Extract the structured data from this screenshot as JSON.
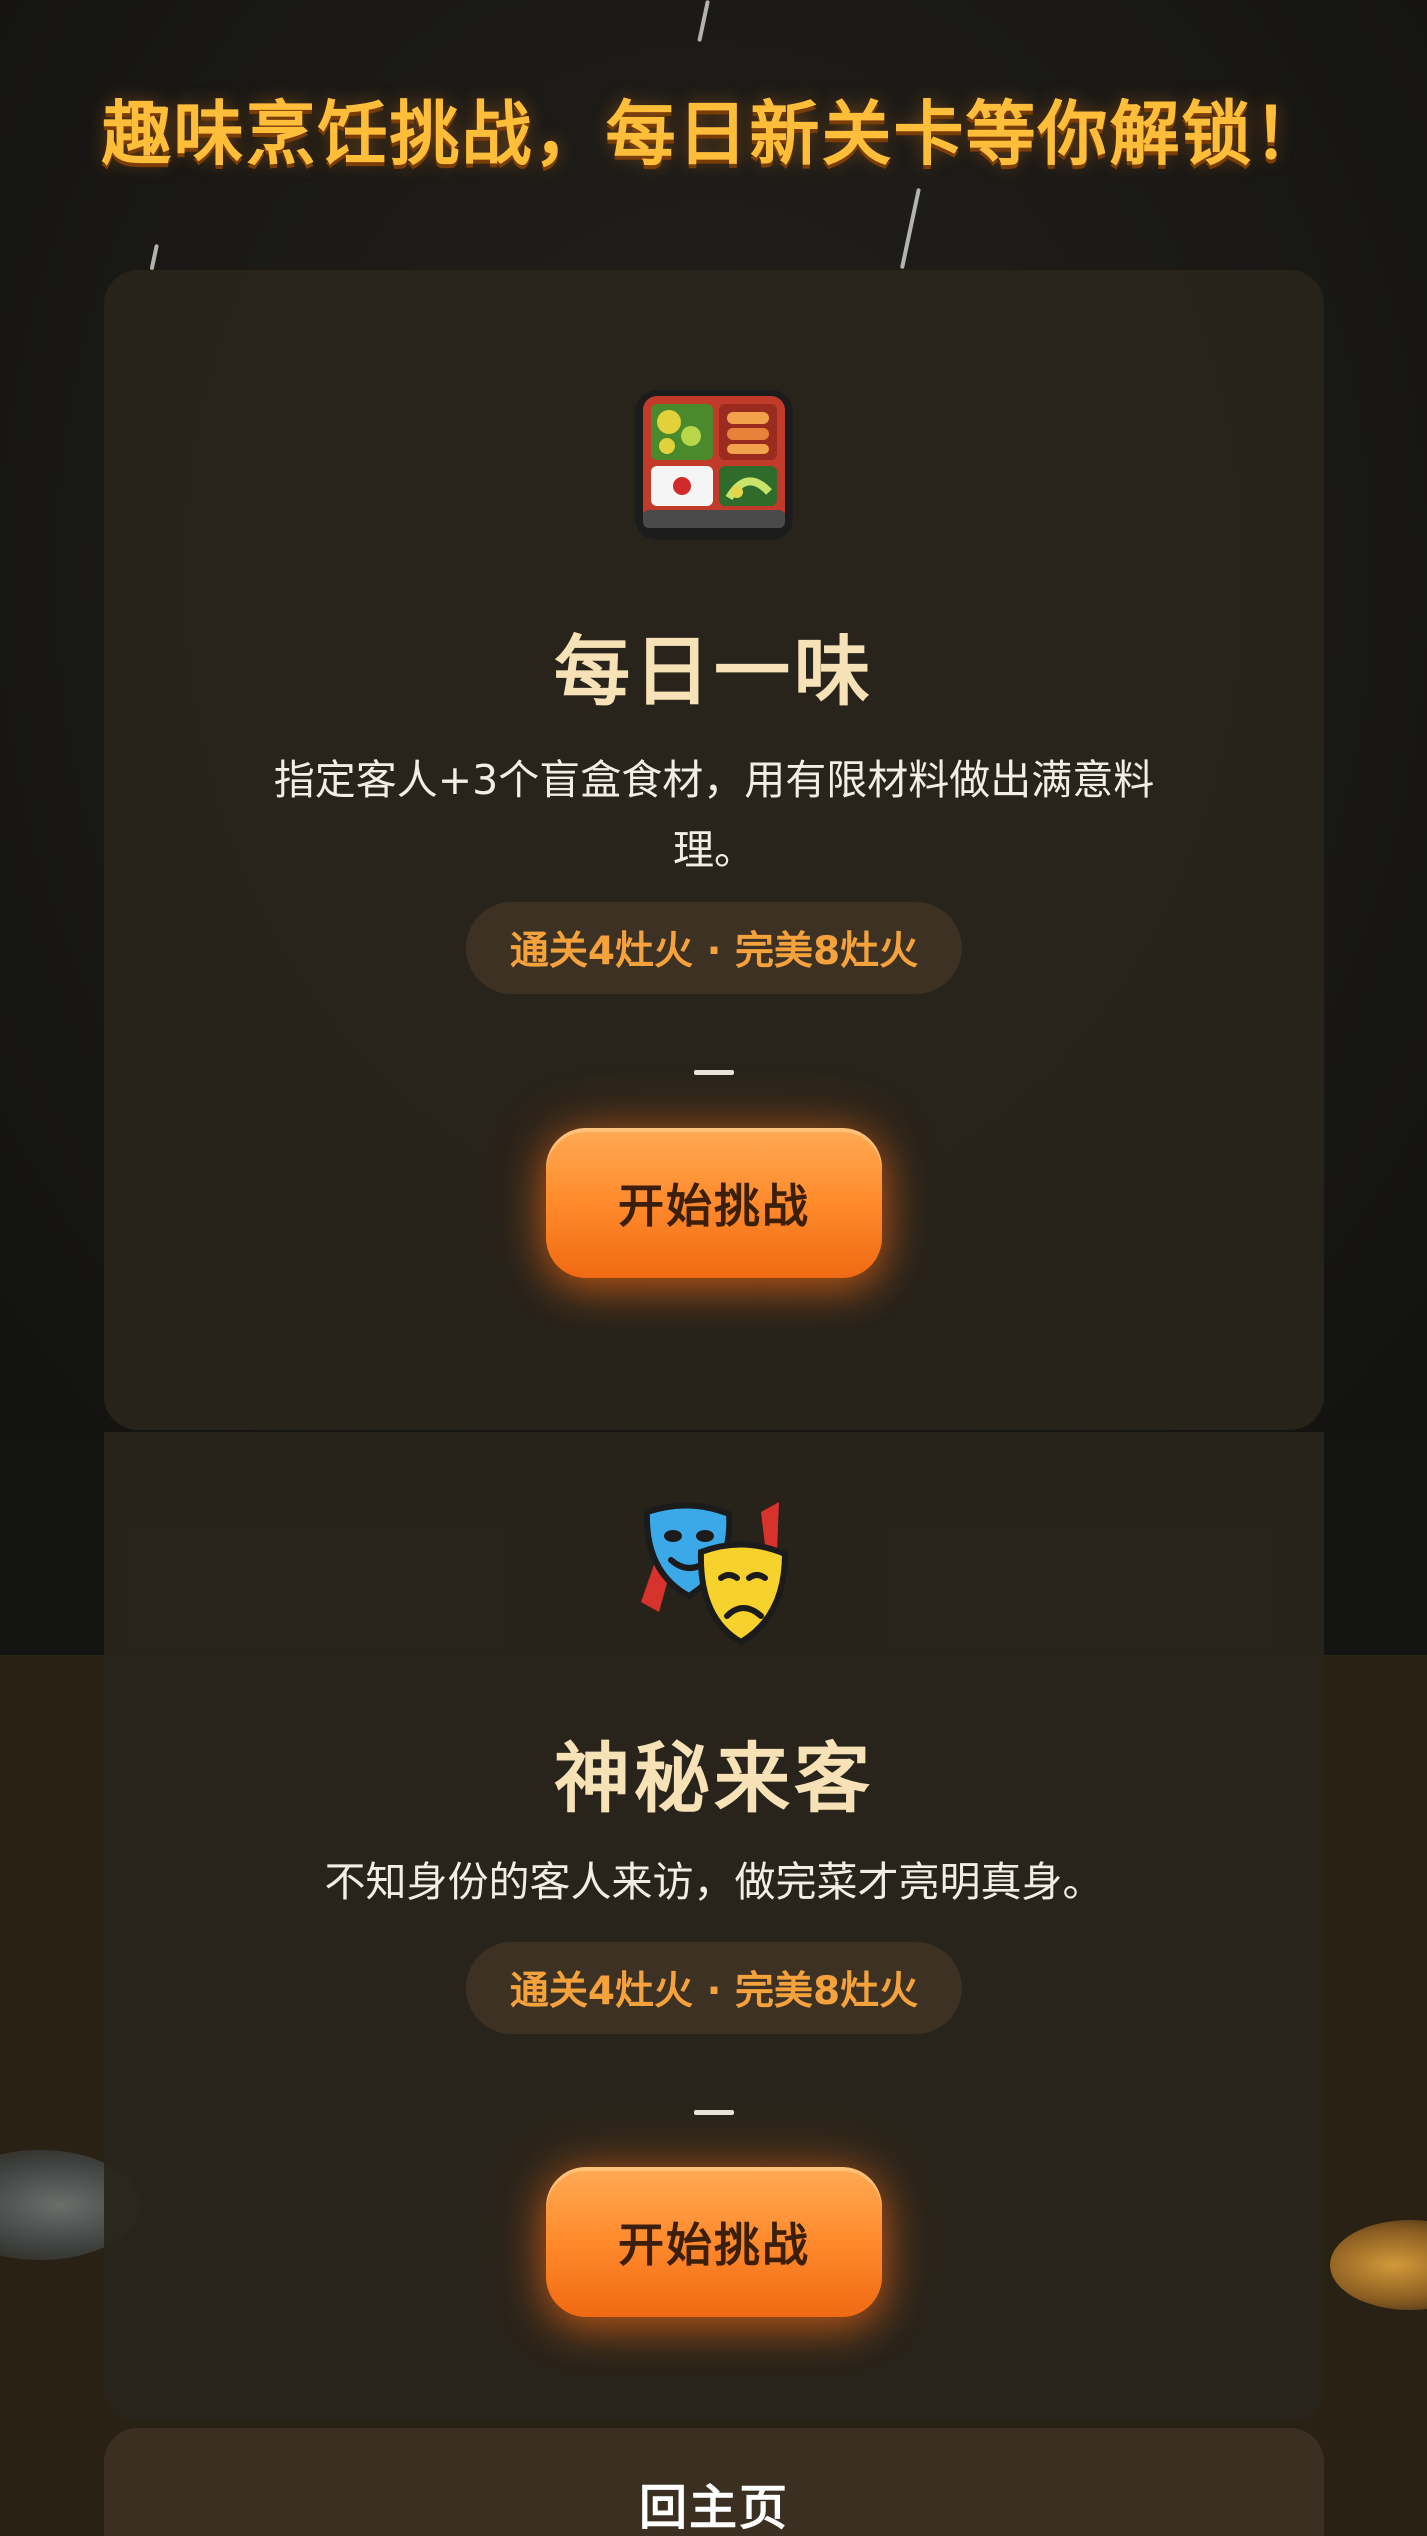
{
  "headline": "趣味烹饪挑战，每日新关卡等你解锁！",
  "challenges": [
    {
      "icon": "bento-box-icon",
      "title": "每日一味",
      "description": "指定客人+3个盲盒食材，用有限材料做出满意料理。",
      "reward": "通关4灶火 · 完美8灶火",
      "button_label": "开始挑战"
    },
    {
      "icon": "theater-masks-icon",
      "title": "神秘来客",
      "description": "不知身份的客人来访，做完菜才亮明真身。",
      "reward": "通关4灶火 · 完美8灶火",
      "button_label": "开始挑战"
    }
  ],
  "home": {
    "label": "回主页"
  },
  "colors": {
    "headline": "#ffbe3a",
    "title": "#f6e2b6",
    "reward": "#f5a23d",
    "button": "#ff8a2c"
  }
}
